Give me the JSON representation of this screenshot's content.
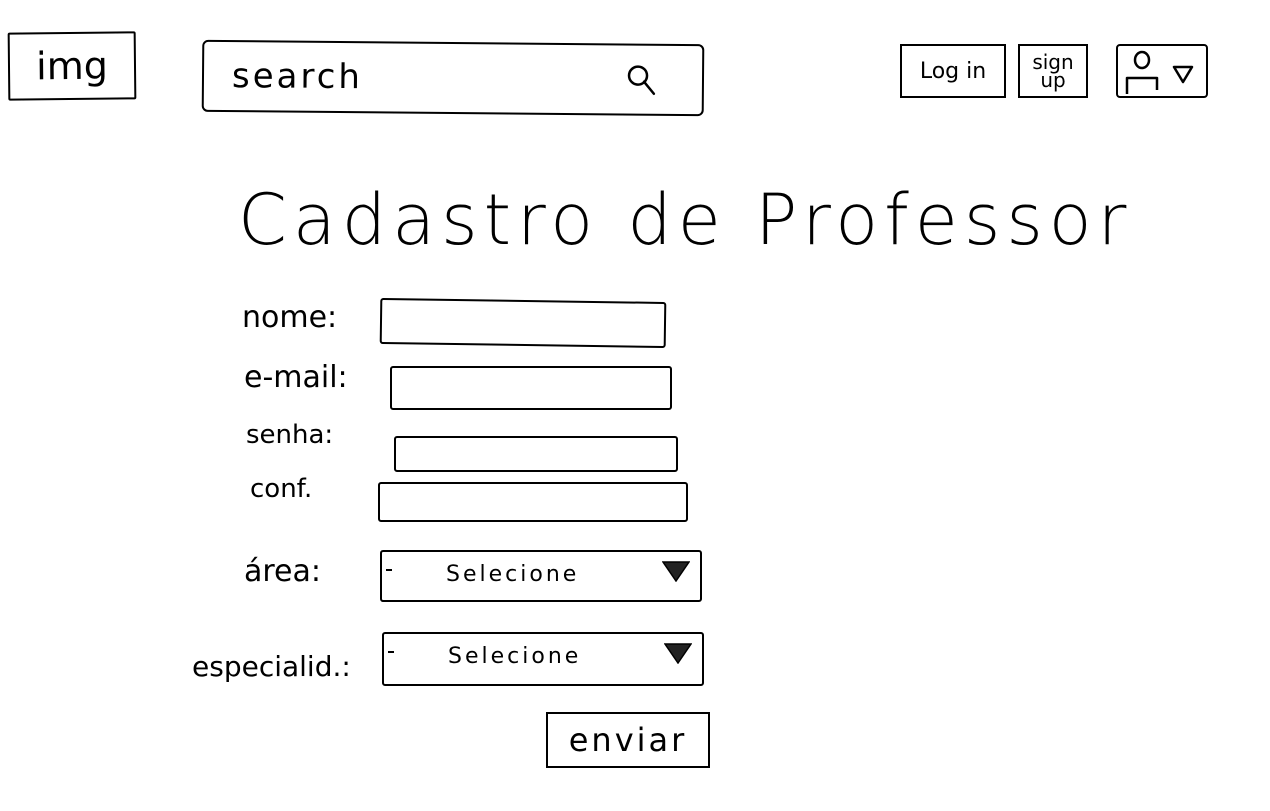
{
  "header": {
    "logo_label": "img",
    "search_placeholder": "search",
    "login_label": "Log in",
    "signup_label": "sign up"
  },
  "title": "Cadastro de Professor",
  "form": {
    "nome_label": "nome:",
    "email_label": "e-mail:",
    "senha_label": "senha:",
    "conf_label": "conf.",
    "area_label": "área:",
    "area_value": "Selecione",
    "especialidade_label": "especialid.:",
    "especialidade_value": "Selecione",
    "submit_label": "enviar"
  },
  "icons": {
    "search": "search-icon",
    "avatar": "avatar-icon",
    "chevron": "chevron-down-icon"
  }
}
